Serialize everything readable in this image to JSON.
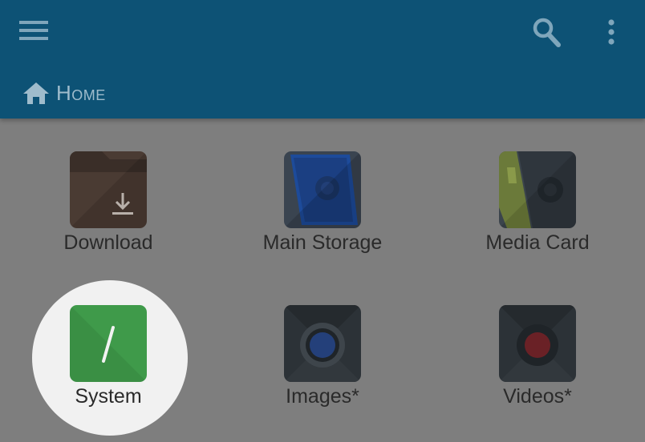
{
  "header": {
    "breadcrumb_label": "Home",
    "icons": [
      "menu-icon",
      "search-icon",
      "more-vert-icon",
      "home-icon"
    ]
  },
  "colors": {
    "appbar": "#0d5275",
    "content_bg": "#7e7e7e",
    "highlight": "#f1f1f1"
  },
  "folders": [
    {
      "id": "download",
      "label": "Download",
      "icon": "folder-download-icon"
    },
    {
      "id": "main-storage",
      "label": "Main Storage",
      "icon": "storage-icon"
    },
    {
      "id": "media-card",
      "label": "Media Card",
      "icon": "sd-card-icon"
    },
    {
      "id": "system",
      "label": "System",
      "icon": "root-slash-icon"
    },
    {
      "id": "images",
      "label": "Images*",
      "icon": "camera-lens-icon"
    },
    {
      "id": "videos",
      "label": "Videos*",
      "icon": "video-record-icon"
    }
  ]
}
